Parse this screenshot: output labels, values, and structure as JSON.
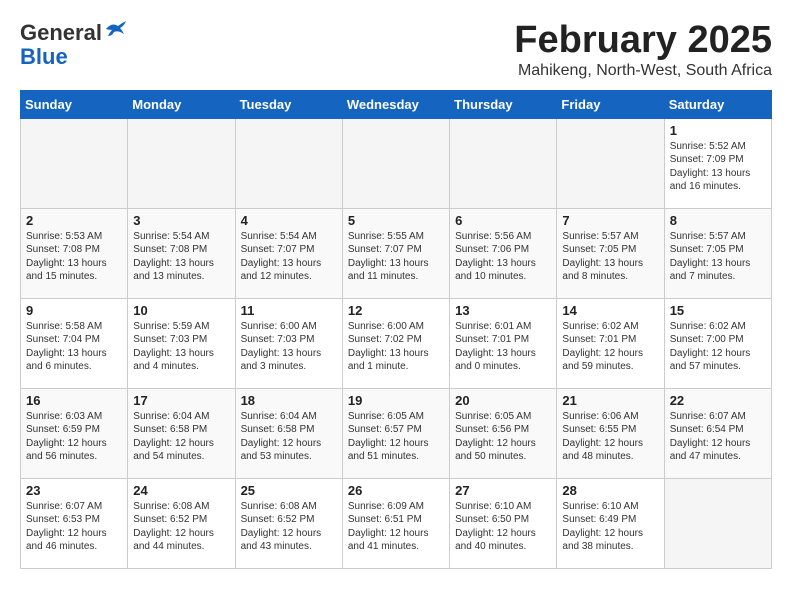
{
  "header": {
    "logo_general": "General",
    "logo_blue": "Blue",
    "month_title": "February 2025",
    "location": "Mahikeng, North-West, South Africa"
  },
  "days_of_week": [
    "Sunday",
    "Monday",
    "Tuesday",
    "Wednesday",
    "Thursday",
    "Friday",
    "Saturday"
  ],
  "weeks": [
    [
      {
        "day": "",
        "info": ""
      },
      {
        "day": "",
        "info": ""
      },
      {
        "day": "",
        "info": ""
      },
      {
        "day": "",
        "info": ""
      },
      {
        "day": "",
        "info": ""
      },
      {
        "day": "",
        "info": ""
      },
      {
        "day": "1",
        "info": "Sunrise: 5:52 AM\nSunset: 7:09 PM\nDaylight: 13 hours\nand 16 minutes."
      }
    ],
    [
      {
        "day": "2",
        "info": "Sunrise: 5:53 AM\nSunset: 7:08 PM\nDaylight: 13 hours\nand 15 minutes."
      },
      {
        "day": "3",
        "info": "Sunrise: 5:54 AM\nSunset: 7:08 PM\nDaylight: 13 hours\nand 13 minutes."
      },
      {
        "day": "4",
        "info": "Sunrise: 5:54 AM\nSunset: 7:07 PM\nDaylight: 13 hours\nand 12 minutes."
      },
      {
        "day": "5",
        "info": "Sunrise: 5:55 AM\nSunset: 7:07 PM\nDaylight: 13 hours\nand 11 minutes."
      },
      {
        "day": "6",
        "info": "Sunrise: 5:56 AM\nSunset: 7:06 PM\nDaylight: 13 hours\nand 10 minutes."
      },
      {
        "day": "7",
        "info": "Sunrise: 5:57 AM\nSunset: 7:05 PM\nDaylight: 13 hours\nand 8 minutes."
      },
      {
        "day": "8",
        "info": "Sunrise: 5:57 AM\nSunset: 7:05 PM\nDaylight: 13 hours\nand 7 minutes."
      }
    ],
    [
      {
        "day": "9",
        "info": "Sunrise: 5:58 AM\nSunset: 7:04 PM\nDaylight: 13 hours\nand 6 minutes."
      },
      {
        "day": "10",
        "info": "Sunrise: 5:59 AM\nSunset: 7:03 PM\nDaylight: 13 hours\nand 4 minutes."
      },
      {
        "day": "11",
        "info": "Sunrise: 6:00 AM\nSunset: 7:03 PM\nDaylight: 13 hours\nand 3 minutes."
      },
      {
        "day": "12",
        "info": "Sunrise: 6:00 AM\nSunset: 7:02 PM\nDaylight: 13 hours\nand 1 minute."
      },
      {
        "day": "13",
        "info": "Sunrise: 6:01 AM\nSunset: 7:01 PM\nDaylight: 13 hours\nand 0 minutes."
      },
      {
        "day": "14",
        "info": "Sunrise: 6:02 AM\nSunset: 7:01 PM\nDaylight: 12 hours\nand 59 minutes."
      },
      {
        "day": "15",
        "info": "Sunrise: 6:02 AM\nSunset: 7:00 PM\nDaylight: 12 hours\nand 57 minutes."
      }
    ],
    [
      {
        "day": "16",
        "info": "Sunrise: 6:03 AM\nSunset: 6:59 PM\nDaylight: 12 hours\nand 56 minutes."
      },
      {
        "day": "17",
        "info": "Sunrise: 6:04 AM\nSunset: 6:58 PM\nDaylight: 12 hours\nand 54 minutes."
      },
      {
        "day": "18",
        "info": "Sunrise: 6:04 AM\nSunset: 6:58 PM\nDaylight: 12 hours\nand 53 minutes."
      },
      {
        "day": "19",
        "info": "Sunrise: 6:05 AM\nSunset: 6:57 PM\nDaylight: 12 hours\nand 51 minutes."
      },
      {
        "day": "20",
        "info": "Sunrise: 6:05 AM\nSunset: 6:56 PM\nDaylight: 12 hours\nand 50 minutes."
      },
      {
        "day": "21",
        "info": "Sunrise: 6:06 AM\nSunset: 6:55 PM\nDaylight: 12 hours\nand 48 minutes."
      },
      {
        "day": "22",
        "info": "Sunrise: 6:07 AM\nSunset: 6:54 PM\nDaylight: 12 hours\nand 47 minutes."
      }
    ],
    [
      {
        "day": "23",
        "info": "Sunrise: 6:07 AM\nSunset: 6:53 PM\nDaylight: 12 hours\nand 46 minutes."
      },
      {
        "day": "24",
        "info": "Sunrise: 6:08 AM\nSunset: 6:52 PM\nDaylight: 12 hours\nand 44 minutes."
      },
      {
        "day": "25",
        "info": "Sunrise: 6:08 AM\nSunset: 6:52 PM\nDaylight: 12 hours\nand 43 minutes."
      },
      {
        "day": "26",
        "info": "Sunrise: 6:09 AM\nSunset: 6:51 PM\nDaylight: 12 hours\nand 41 minutes."
      },
      {
        "day": "27",
        "info": "Sunrise: 6:10 AM\nSunset: 6:50 PM\nDaylight: 12 hours\nand 40 minutes."
      },
      {
        "day": "28",
        "info": "Sunrise: 6:10 AM\nSunset: 6:49 PM\nDaylight: 12 hours\nand 38 minutes."
      },
      {
        "day": "",
        "info": ""
      }
    ]
  ]
}
